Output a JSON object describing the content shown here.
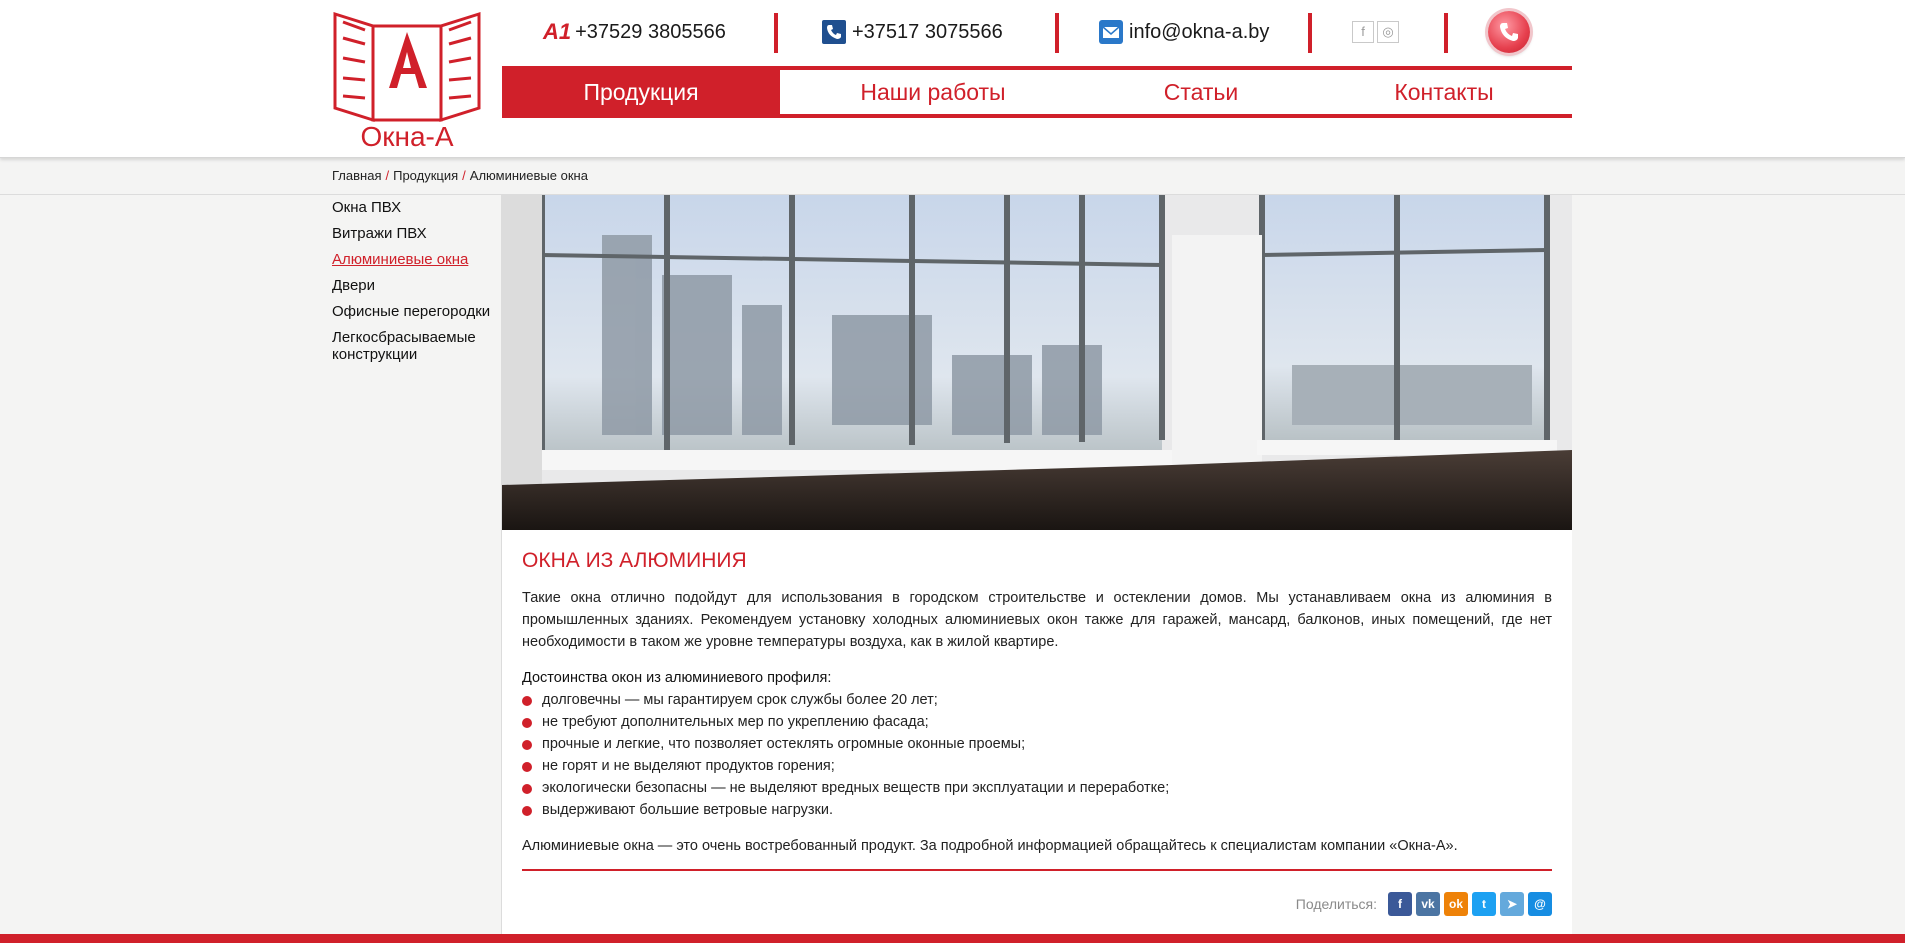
{
  "header": {
    "logo_text": "Окна-А",
    "phone1": "+37529 3805566",
    "phone2": "+37517 3075566",
    "email": "info@okna-a.by",
    "operator_icon": "A1"
  },
  "nav": {
    "items": [
      {
        "label": "Продукция",
        "active": true
      },
      {
        "label": "Наши работы"
      },
      {
        "label": "Статьи"
      },
      {
        "label": "Контакты"
      }
    ]
  },
  "breadcrumbs": [
    "Главная",
    "Продукция",
    "Алюминиевые окна"
  ],
  "sidebar": {
    "items": [
      {
        "label": "Окна ПВХ"
      },
      {
        "label": "Витражи ПВХ"
      },
      {
        "label": "Алюминиевые окна",
        "active": true
      },
      {
        "label": "Двери"
      },
      {
        "label": "Офисные перегородки"
      },
      {
        "label": "Легкосбрасываемые конструкции"
      }
    ]
  },
  "article": {
    "title": "ОКНА ИЗ АЛЮМИНИЯ",
    "intro": "Такие окна отлично подойдут для использования в городском строительстве и остеклении домов. Мы устанавливаем окна из алюминия в промышленных зданиях. Рекомендуем установку холодных алюминиевых окон также для гаражей, мансард, балконов, иных помещений, где нет необходимости в таком же уровне температуры воздуха, как в жилой квартире.",
    "advantages_title": "Достоинства окон из алюминиевого профиля:",
    "advantages": [
      "долговечны — мы гарантируем срок службы более 20 лет;",
      "не требуют дополнительных мер по укреплению фасада;",
      "прочные и легкие, что позволяет остеклять огромные оконные проемы;",
      "не горят и не выделяют продуктов горения;",
      "экологически безопасны — не выделяют вредных веществ при эксплуатации и переработке;",
      "выдерживают большие ветровые нагрузки."
    ],
    "outro": "Алюминиевые окна — это очень востребованный продукт. За подробной информацией обращайтесь к специалистам компании «Окна-А»."
  },
  "share": {
    "label": "Поделиться:",
    "buttons": [
      {
        "name": "facebook",
        "glyph": "f",
        "color": "#3b5998"
      },
      {
        "name": "vkontakte",
        "glyph": "vk",
        "color": "#4c75a3"
      },
      {
        "name": "odnoklassniki",
        "glyph": "ok",
        "color": "#ee8208"
      },
      {
        "name": "twitter",
        "glyph": "t",
        "color": "#1da1f2"
      },
      {
        "name": "telegram",
        "glyph": "➤",
        "color": "#64a9dc"
      },
      {
        "name": "moimir",
        "glyph": "@",
        "color": "#168de2"
      }
    ]
  },
  "colors": {
    "accent": "#d0202a"
  }
}
